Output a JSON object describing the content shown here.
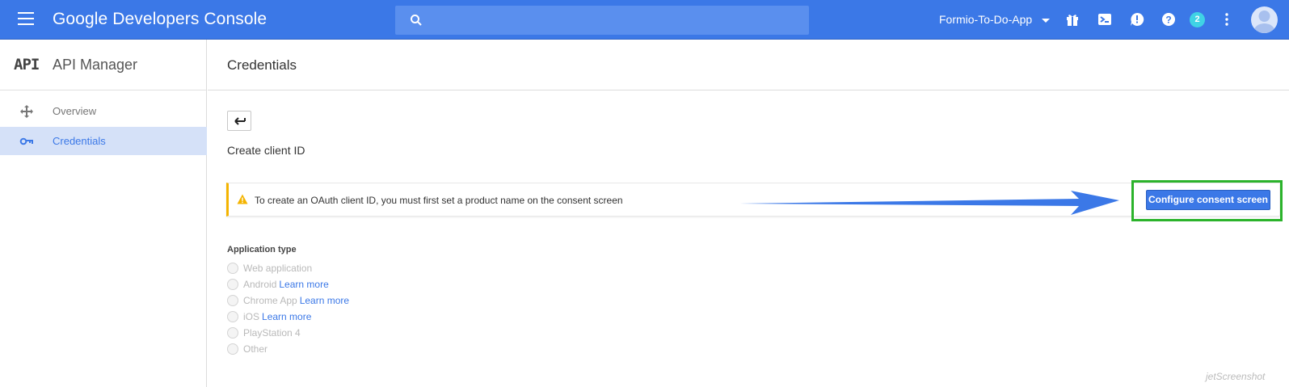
{
  "topbar": {
    "brand_google": "Google",
    "brand_rest": "Developers Console",
    "project_name": "Formio-To-Do-App",
    "notification_count": "2"
  },
  "sidebar": {
    "logo_text": "API",
    "title": "API Manager",
    "items": [
      {
        "label": "Overview",
        "icon": "overview-icon",
        "active": false
      },
      {
        "label": "Credentials",
        "icon": "key-icon",
        "active": true
      }
    ]
  },
  "main": {
    "title": "Credentials",
    "subtitle": "Create client ID",
    "alert_text": "To create an OAuth client ID, you must first set a product name on the consent screen",
    "configure_button": "Configure consent screen",
    "application_type_label": "Application type",
    "options": [
      {
        "label": "Web application",
        "link": ""
      },
      {
        "label": "Android",
        "link": "Learn more"
      },
      {
        "label": "Chrome App",
        "link": "Learn more"
      },
      {
        "label": "iOS",
        "link": "Learn more"
      },
      {
        "label": "PlayStation 4",
        "link": ""
      },
      {
        "label": "Other",
        "link": ""
      }
    ]
  },
  "watermark": "jetScreenshot",
  "colors": {
    "topbar": "#3b78e7",
    "accent": "#3b78e7",
    "warning": "#f4b400",
    "highlight": "#2bb32b",
    "active_item_bg": "#d5e1f8"
  }
}
